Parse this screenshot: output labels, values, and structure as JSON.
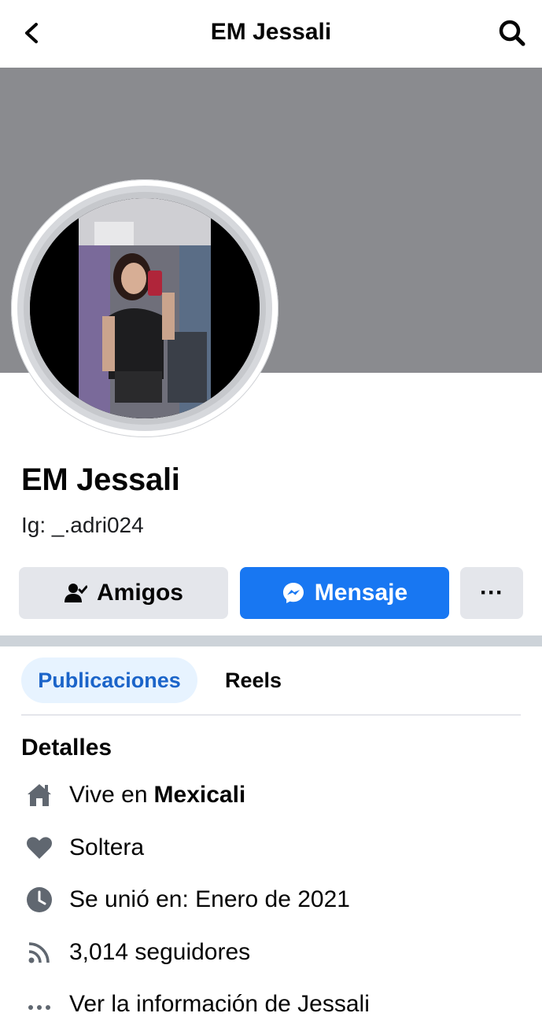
{
  "header": {
    "title": "EM Jessali"
  },
  "colors": {
    "cover": "#8a8b8f",
    "accent": "#1877f2",
    "tab_active_bg": "#e7f3ff",
    "icon_gray": "#606770"
  },
  "profile": {
    "name": "EM Jessali",
    "bio": "Ig: _.adri024"
  },
  "actions": {
    "friends_label": "Amigos",
    "message_label": "Mensaje",
    "more_label": "···"
  },
  "tabs": [
    {
      "label": "Publicaciones",
      "active": true
    },
    {
      "label": "Reels",
      "active": false
    }
  ],
  "details": {
    "heading": "Detalles",
    "lives_prefix": "Vive en",
    "lives_city": "Mexicali",
    "relationship": "Soltera",
    "joined": "Se unió en: Enero de 2021",
    "followers": "3,014 seguidores",
    "more_info": "Ver la información de Jessali"
  },
  "icons": [
    "back-arrow-icon",
    "search-icon",
    "add-friend-icon",
    "messenger-icon",
    "more-icon",
    "home-icon",
    "heart-icon",
    "clock-icon",
    "rss-icon",
    "ellipsis-icon"
  ]
}
